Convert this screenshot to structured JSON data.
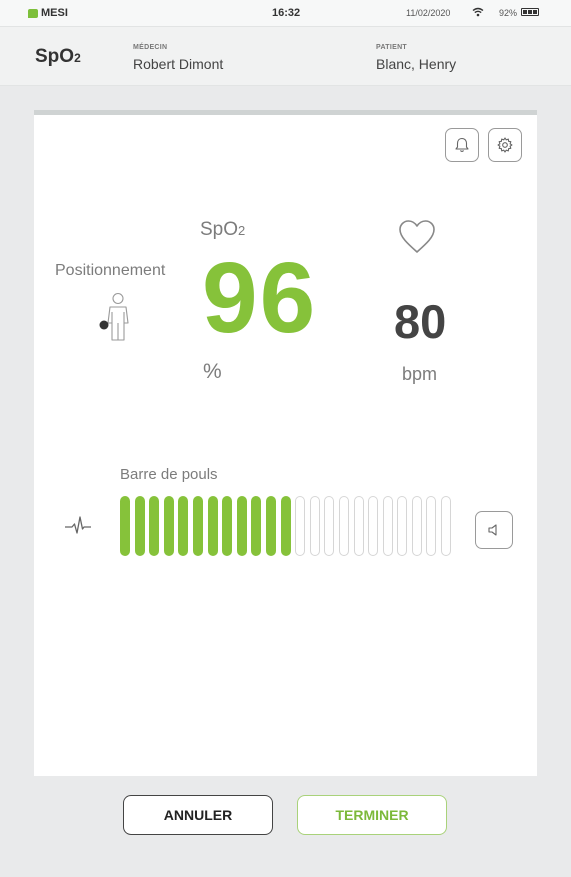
{
  "status_bar": {
    "brand": "MESI",
    "time": "16:32",
    "date": "11/02/2020",
    "battery": "92%",
    "icons": [
      "wifi-icon",
      "battery-icon"
    ]
  },
  "header": {
    "title_main": "SpO",
    "title_sub": "2",
    "doctor_label": "MÉDECIN",
    "doctor_name": "Robert Dimont",
    "patient_label": "PATIENT",
    "patient_name": "Blanc, Henry"
  },
  "measurement": {
    "spo2_label_main": "SpO",
    "spo2_label_sub": "2",
    "spo2_value": "96",
    "spo2_unit": "%",
    "heart_rate_value": "80",
    "heart_rate_unit": "bpm",
    "positioning_label": "Positionnement"
  },
  "pulse_bar": {
    "label": "Barre de pouls",
    "total_segments": 23,
    "active_segments": 12
  },
  "actions": {
    "cancel": "ANNULER",
    "finish": "TERMINER"
  },
  "colors": {
    "accent": "#86c23a",
    "text": "#444444"
  }
}
